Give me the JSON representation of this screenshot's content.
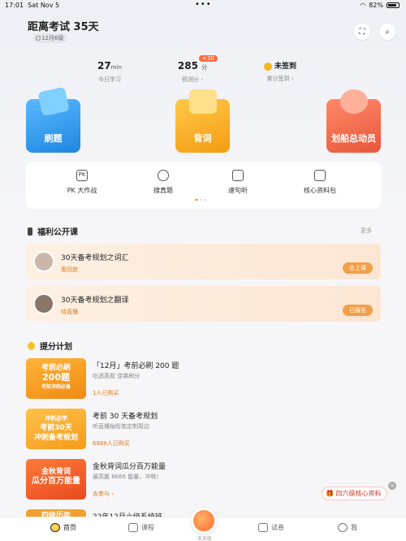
{
  "status_bar": {
    "time": "17:01",
    "date": "Sat Nov 5",
    "dots": "•••",
    "battery": "82%"
  },
  "header": {
    "title": "距离考试 35天",
    "chip": "12月6级"
  },
  "icons": {
    "scan": "scan-icon",
    "search": "search-icon"
  },
  "stats": [
    {
      "value": "27",
      "unit": "min",
      "label": "今日学习"
    },
    {
      "value": "285",
      "unit": "分",
      "badge": "+30",
      "label": "预测分 ›"
    },
    {
      "value": "未签到",
      "unit": "",
      "label": "累计签到 ›"
    }
  ],
  "big_buttons": [
    {
      "label": "刷题",
      "color": "#2f9ae8"
    },
    {
      "label": "背词",
      "color": "#f4a623"
    },
    {
      "label": "划船总动员",
      "color": "#f06a4a"
    }
  ],
  "grid": [
    {
      "label": "PK 大作战",
      "icon": "pk-icon"
    },
    {
      "label": "搜真题",
      "icon": "search-icon"
    },
    {
      "label": "速句听",
      "icon": "radio-icon"
    },
    {
      "label": "核心资料包",
      "icon": "folder-icon"
    }
  ],
  "sections": {
    "welfare": "福利公开课",
    "more": "更多",
    "plan": "提分计划"
  },
  "courses": [
    {
      "title": "30天备考规划之词汇",
      "status": "看回放",
      "button": "去上课"
    },
    {
      "title": "30天备考规划之翻译",
      "status": "待直播",
      "button": "已报名"
    }
  ],
  "plans": [
    {
      "thumb_lines": [
        "考前必刷",
        "200题",
        "考前冲刺必备"
      ],
      "thumb_color": "#f59a23",
      "title": "「12月」考前必刷 200 题",
      "subtitle": "吃透真题 逆袭刷分",
      "bought": "1人已购买"
    },
    {
      "thumb_lines": [
        "冲刺必学",
        "考前30天",
        "冲刺备考规划"
      ],
      "thumb_color": "#f5a623",
      "title": "考前 30 天备考规划",
      "subtitle": "听直播抽衔笔定制周边",
      "bought": "6888人已购买"
    },
    {
      "thumb_lines": [
        "金秋背词",
        "瓜分百万能量"
      ],
      "thumb_color": "#f0582c",
      "title": "金秋背词瓜分百万能量",
      "subtitle": "最高赢 6666 能量，冲鸭！",
      "bought": "去参与 ›"
    },
    {
      "thumb_lines": [
        "四级历年"
      ],
      "thumb_color": "#f3a02e",
      "title": "22年12月六级系统班",
      "subtitle": "",
      "bought": ""
    }
  ],
  "float": {
    "label": "四六级核心资料",
    "close": "×"
  },
  "tabbar": [
    {
      "label": "首页",
      "icon": "home-icon",
      "active": true
    },
    {
      "label": "课程",
      "icon": "video-icon",
      "active": false
    },
    {
      "label": "天天练",
      "icon": "practice-icon",
      "active": false
    },
    {
      "label": "试卷",
      "icon": "paper-icon",
      "active": false
    },
    {
      "label": "我",
      "icon": "user-icon",
      "active": false
    }
  ]
}
